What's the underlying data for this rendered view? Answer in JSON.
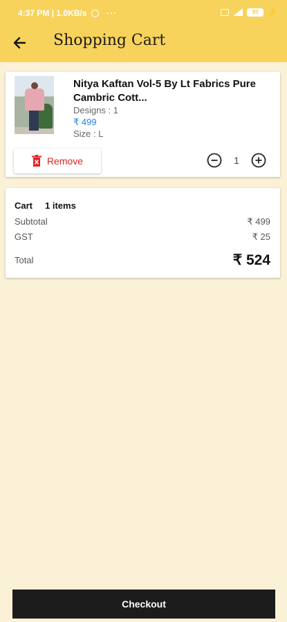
{
  "status_bar": {
    "time": "4:37 PM",
    "speed": "1.0KB/s",
    "more": "···",
    "battery": "89"
  },
  "app_bar": {
    "title": "Shopping Cart"
  },
  "cart_item": {
    "name": "Nitya Kaftan Vol-5 By Lt Fabrics Pure Cambric Cott...",
    "designs": "Designs : 1",
    "price": "₹ 499",
    "size": "Size : L",
    "remove_label": "Remove",
    "quantity": "1"
  },
  "summary": {
    "cart_label": "Cart",
    "items_count": "1 items",
    "subtotal_label": "Subtotal",
    "subtotal_value": "₹ 499",
    "gst_label": "GST",
    "gst_value": "₹ 25",
    "total_label": "Total",
    "total_value": "₹ 524"
  },
  "checkout_label": "Checkout",
  "colors": {
    "accent": "#f7d35c",
    "background": "#fbf1d6",
    "price_blue": "#1f7ee6",
    "remove_red": "#e02323",
    "checkout_bg": "#1c1c1c"
  },
  "icons": [
    "back-arrow-icon",
    "trash-icon",
    "minus-circle-icon",
    "plus-circle-icon",
    "alarm-icon",
    "signal-icon",
    "battery-icon"
  ]
}
